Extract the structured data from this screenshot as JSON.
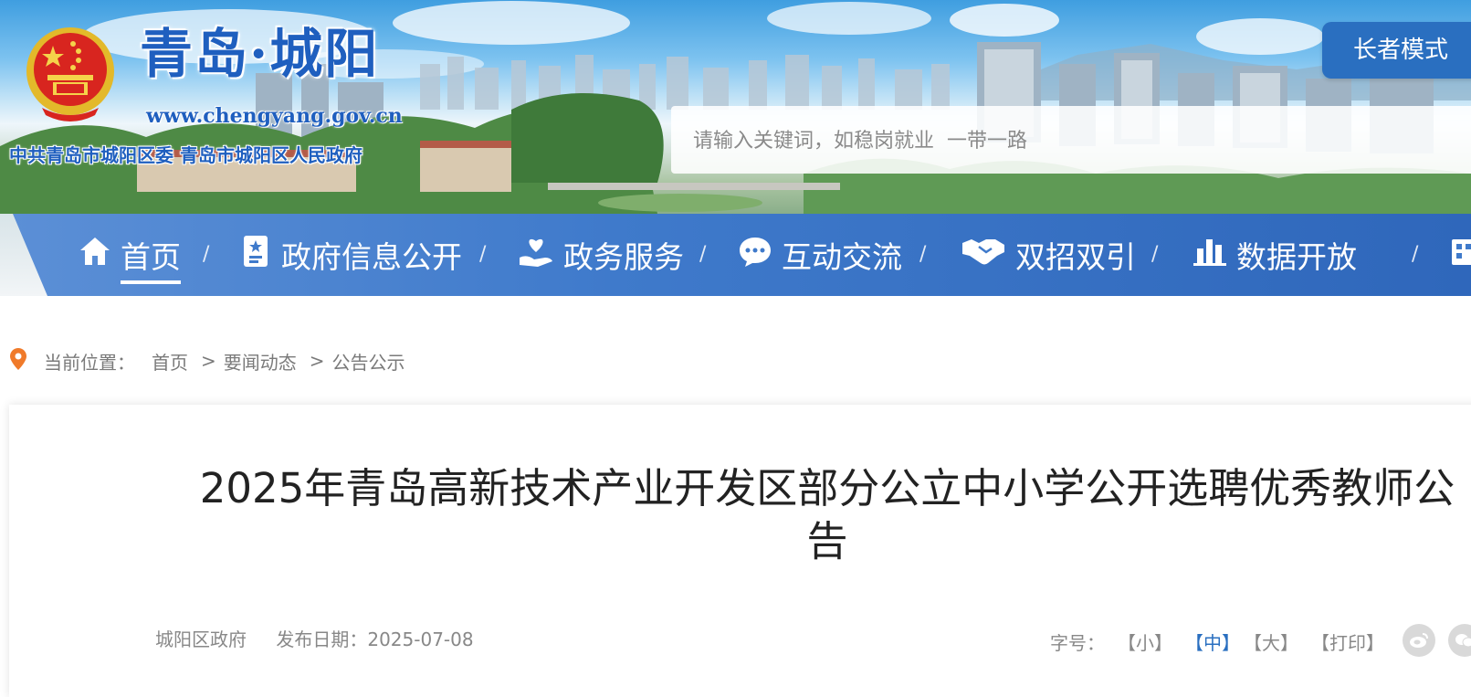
{
  "header": {
    "site_title": "青岛·城阳",
    "site_url": "www.chengyang.gov.cn",
    "site_subtitle": "中共青岛市城阳区委  青岛市城阳区人民政府",
    "elder_mode_label": "长者模式",
    "search_placeholder": "请输入关键词，如稳岗就业  一带一路"
  },
  "nav": {
    "items": [
      {
        "label": "首页",
        "icon": "home-icon",
        "active": true
      },
      {
        "label": "政府信息公开",
        "icon": "document-icon"
      },
      {
        "label": "政务服务",
        "icon": "hand-heart-icon"
      },
      {
        "label": "互动交流",
        "icon": "chat-bubble-icon"
      },
      {
        "label": "双招双引",
        "icon": "handshake-icon"
      },
      {
        "label": "数据开放",
        "icon": "bar-chart-icon"
      }
    ],
    "separator": "/"
  },
  "breadcrumb": {
    "label": "当前位置：",
    "items": [
      "首页",
      "要闻动态",
      "公告公示"
    ],
    "separator": ">"
  },
  "article": {
    "title": "2025年青岛高新技术产业开发区部分公立中小学公开选聘优秀教师公告",
    "source": "城阳区政府",
    "date_label": "发布日期：",
    "date": "2025-07-08",
    "font_size_label": "字号：",
    "font_small": "【小】",
    "font_medium": "【中】",
    "font_large": "【大】",
    "print": "【打印】",
    "share_icons": [
      "weibo-icon",
      "wechat-icon"
    ]
  },
  "colors": {
    "nav_blue": "#3f7acb",
    "title_blue": "#1f5fbf",
    "active_font_size": "#2a6fc0"
  }
}
